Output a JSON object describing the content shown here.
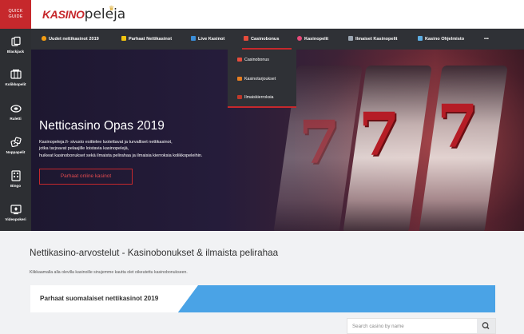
{
  "quick_guide": {
    "line1": "QUICK",
    "line2": "GUIDE"
  },
  "sidebar": {
    "items": [
      {
        "label": "Blackjack",
        "icon": "cards-icon"
      },
      {
        "label": "Kolikkopelit",
        "icon": "slot-machine-icon"
      },
      {
        "label": "Ruletti",
        "icon": "roulette-icon"
      },
      {
        "label": "Noppapelit",
        "icon": "dice-icon"
      },
      {
        "label": "Bingo",
        "icon": "bingo-icon"
      },
      {
        "label": "Videopokeri",
        "icon": "video-poker-icon"
      }
    ]
  },
  "logo": {
    "part1": "KASINO",
    "part2": "peleja"
  },
  "nav": {
    "items": [
      {
        "label": "Uudet nettikasinot 2019",
        "icon": "fire-icon",
        "color": "#f39c12"
      },
      {
        "label": "Parhaat Nettikasinot",
        "icon": "trophy-icon",
        "color": "#f1c40f"
      },
      {
        "label": "Live Kasinot",
        "icon": "tv-icon",
        "color": "#3b8ed8"
      },
      {
        "label": "Casinobonus",
        "icon": "gift-icon",
        "color": "#e74c3c"
      },
      {
        "label": "Kasinopelit",
        "icon": "chip-icon",
        "color": "#e84a7a"
      },
      {
        "label": "Ilmaiset Kasinopelit",
        "icon": "controller-icon",
        "color": "#9aa5b1"
      },
      {
        "label": "Kasino Ohjelmisto",
        "icon": "software-icon",
        "color": "#5dade2"
      },
      {
        "label": "•••",
        "icon": "more-icon",
        "color": "#ffffff"
      }
    ],
    "active_color": "#c6282c"
  },
  "dropdown": {
    "items": [
      {
        "label": "Casinobonus",
        "icon": "gift-icon"
      },
      {
        "label": "Kasinotarjoukset",
        "icon": "chest-icon"
      },
      {
        "label": "Ilmaiskierroksia",
        "icon": "ticket-icon"
      }
    ]
  },
  "hero": {
    "title": "Netticasino Opas 2019",
    "lines": [
      "Kasinopeleja.fi- sivusto esittelee luotettavat ja turvalliset nettikasinot,",
      "jotka tarjoavat pelaajille loistavia kasinopelejä,",
      "huikeat kasinobonukset sekä ilmaista pelirahaa ja ilmaisia kierroksia kolikkopeleihin."
    ],
    "button": "Parhaat online kasinot"
  },
  "content": {
    "title": "Nettikasino-arvostelut - Kasinobonukset & ilmaista pelirahaa",
    "subtitle": "Klikkaamalla alla olevilla kasinoille sinujemme kautta olet oikeutettu kasinobonukseen.",
    "banner": "Parhaat suomalaiset nettikasinot 2019"
  },
  "search": {
    "placeholder": "Search casino by name"
  },
  "colors": {
    "brand_red": "#c6282c",
    "nav_dark": "#2f3136",
    "banner_blue": "#4aa3e6"
  }
}
